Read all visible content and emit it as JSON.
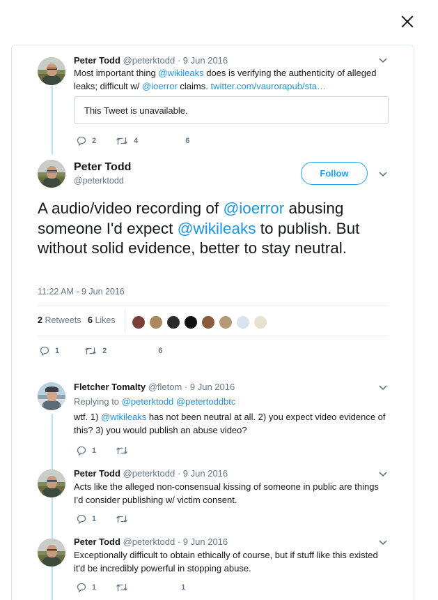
{
  "close": {
    "icon": "close-icon"
  },
  "parent_tweet": {
    "name": "Peter Todd",
    "handle": "@peterktodd",
    "date": "9 Jun 2016",
    "text_1": "Most important thing ",
    "mention_1": "@wikileaks",
    "text_2": " does is verifying the authenticity of alleged leaks; difficult w/ ",
    "mention_2": "@ioerror",
    "text_3": " claims. ",
    "link": "twitter.com/vaurorapub/sta…",
    "quoted_unavailable": "This Tweet is unavailable.",
    "replies": "2",
    "retweets": "4",
    "likes": "6"
  },
  "main_tweet": {
    "name": "Peter Todd",
    "handle": "@peterktodd",
    "follow_label": "Follow",
    "text_1": "A audio/video recording of ",
    "mention_1": "@ioerror",
    "text_2": " abusing someone I'd expect ",
    "mention_2": "@wikileaks",
    "text_3": " to publish. But without solid evidence, better to stay neutral.",
    "timestamp": "11:22 AM - 9 Jun 2016",
    "retweets_count": "2",
    "retweets_label": "Retweets",
    "likes_count": "6",
    "likes_label": "Likes",
    "replies": "1",
    "retweets": "2",
    "likes": "6"
  },
  "replies": [
    {
      "name": "Fletcher Tomalty",
      "handle": "@fletom",
      "date": "9 Jun 2016",
      "replying_to_label": "Replying to ",
      "replying_to_1": "@peterktodd",
      "replying_to_2": "@petertoddbtc",
      "text_1": "wtf. 1) ",
      "mention_1": "@wikileaks",
      "text_2": " has not been neutral at all. 2) you expect video evidence of this? 3) you would publish an abuse video?",
      "replies": "1",
      "retweets": "",
      "likes": ""
    },
    {
      "name": "Peter Todd",
      "handle": "@peterktodd",
      "date": "9 Jun 2016",
      "text": "Acts like the alleged non-consensual kissing of someone in public are things I'd consider publishing w/ victim consent.",
      "replies": "1",
      "retweets": "",
      "likes": ""
    },
    {
      "name": "Peter Todd",
      "handle": "@peterktodd",
      "date": "9 Jun 2016",
      "text": "Exceptionally difficult to obtain ethically of course, but if stuff like this existed it'd be incredibly powerful in stopping abuse.",
      "replies": "1",
      "retweets": "",
      "likes": "1"
    }
  ],
  "likers": [
    "#7b3f3a",
    "#a88a5c",
    "#2b2b2b",
    "#111111",
    "#8a5a3c",
    "#b59a7a",
    "#d9e3ef",
    "#e8e0d0"
  ],
  "colors": {
    "link": "#1b95e0",
    "follow": "#1da1f2",
    "thread_line": "#b6e0f5"
  }
}
